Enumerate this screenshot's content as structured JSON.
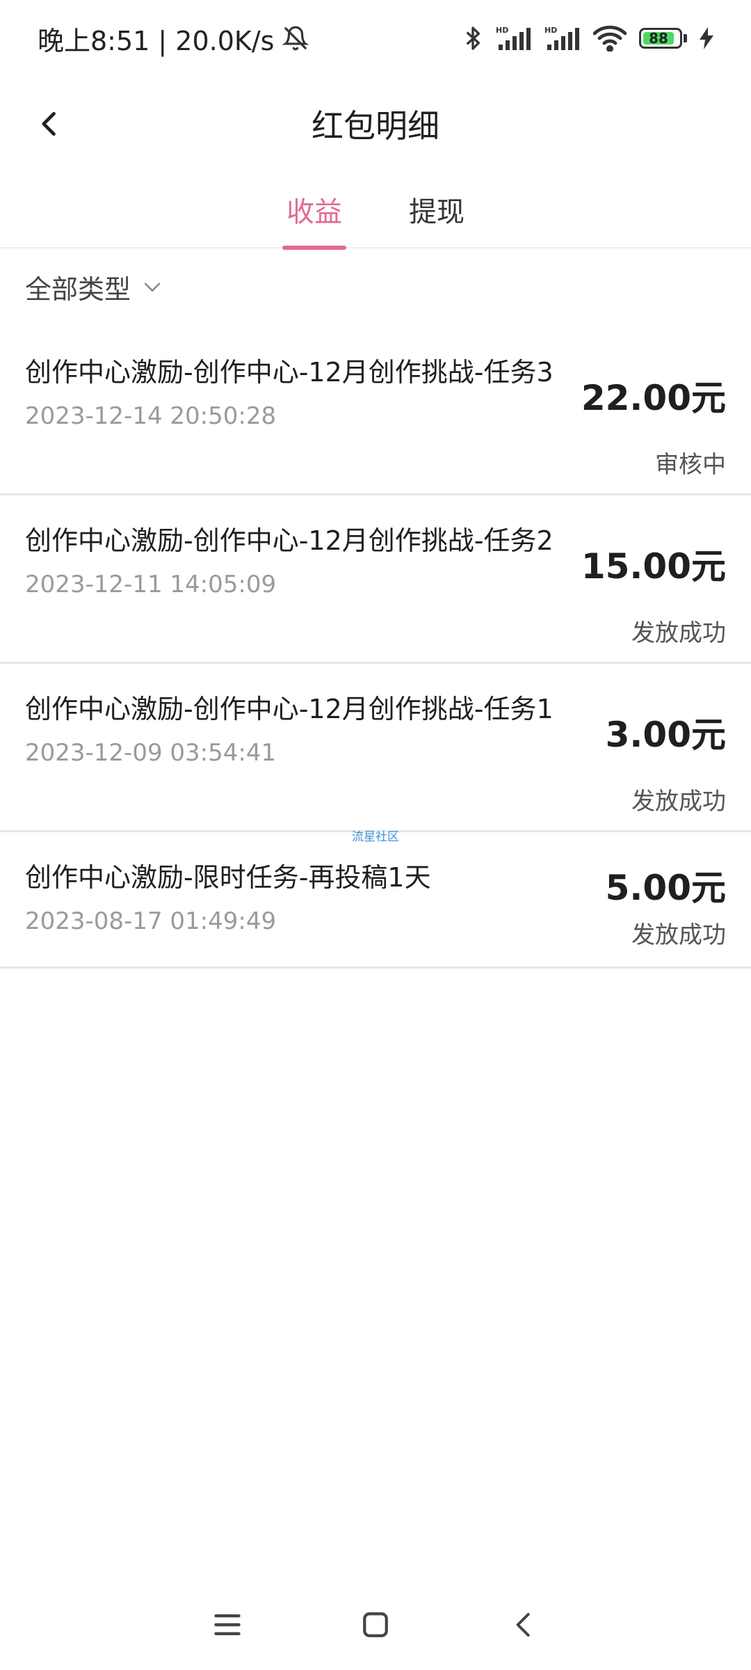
{
  "status_bar": {
    "time": "晚上8:51 | 20.0K/s",
    "battery": "88",
    "colors": {
      "battery_fill": "#4cd964"
    }
  },
  "header": {
    "title": "红包明细"
  },
  "tabs": [
    {
      "label": "收益",
      "active": true
    },
    {
      "label": "提现",
      "active": false
    }
  ],
  "filter": {
    "label": "全部类型"
  },
  "items": [
    {
      "title": "创作中心激励-创作中心-12月创作挑战-任务3",
      "time": "2023-12-14 20:50:28",
      "amount": "22.00元",
      "status": "审核中"
    },
    {
      "title": "创作中心激励-创作中心-12月创作挑战-任务2",
      "time": "2023-12-11 14:05:09",
      "amount": "15.00元",
      "status": "发放成功"
    },
    {
      "title": "创作中心激励-创作中心-12月创作挑战-任务1",
      "time": "2023-12-09 03:54:41",
      "amount": "3.00元",
      "status": "发放成功"
    },
    {
      "title": "创作中心激励-限时任务-再投稿1天",
      "time": "2023-08-17 01:49:49",
      "amount": "5.00元",
      "status": "发放成功"
    }
  ],
  "watermark": "流星社区",
  "accent_color": "#e06b95"
}
